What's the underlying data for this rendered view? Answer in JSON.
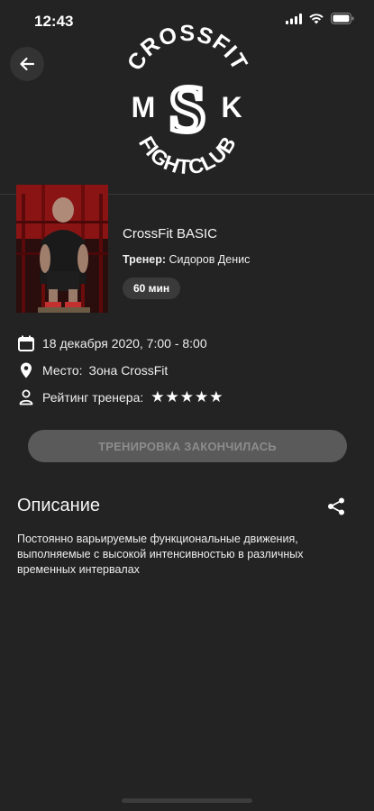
{
  "status_bar": {
    "time": "12:43",
    "icons": [
      "signal-icon",
      "wifi-icon",
      "battery-icon"
    ]
  },
  "header": {
    "back_icon": "arrow-left-icon",
    "logo": {
      "top_text": "CROSSFIT",
      "left_letter": "M",
      "middle_letter": "S",
      "right_letter": "K",
      "bottom_text": "FIGHTCLUB"
    }
  },
  "workout": {
    "title": "CrossFit BASIC",
    "trainer_label": "Тренер:",
    "trainer_name": "Сидоров Денис",
    "duration": "60 мин"
  },
  "details": {
    "date": "18 декабря 2020, 7:00 - 8:00",
    "place_label": "Место:",
    "place_value": "Зона CrossFit",
    "rating_label": "Рейтинг тренера:",
    "rating": 5,
    "rating_stars": "★★★★★"
  },
  "action_button": {
    "label": "ТРЕНИРОВКА ЗАКОНЧИЛАСЬ"
  },
  "description": {
    "title": "Описание",
    "share_icon": "share-icon",
    "text": "Постоянно варьируемые функциональные движения, выполняемые с высокой интенсивностью в различных временных интервалах"
  },
  "colors": {
    "background": "#232323",
    "button_disabled": "#5a5a5a",
    "badge": "#3a3a3a"
  }
}
